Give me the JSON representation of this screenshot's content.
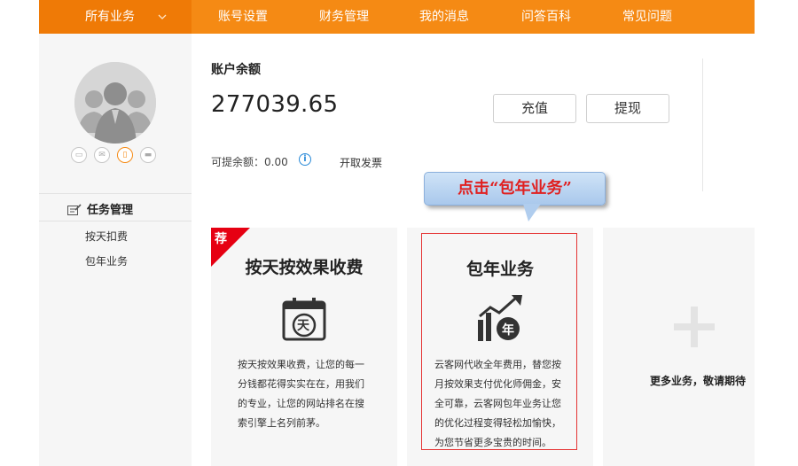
{
  "nav": {
    "all_services": "所有业务",
    "items": [
      "账号设置",
      "财务管理",
      "我的消息",
      "问答百科",
      "常见问题"
    ]
  },
  "sidebar": {
    "section_title": "任务管理",
    "links": [
      "按天扣费",
      "包年业务"
    ]
  },
  "balance": {
    "title": "账户余额",
    "amount": "277039.65",
    "recharge_label": "充值",
    "withdraw_label": "提现",
    "available_label": "可提余额：0.00",
    "invoice_label": "开取发票"
  },
  "callout": {
    "text": "点击“包年业务”"
  },
  "cards": [
    {
      "badge": "荐",
      "title": "按天按效果收费",
      "icon_char": "天",
      "desc": [
        "按天按效果收费，让您的每一",
        "分钱都花得实实在在，用我们",
        "的专业，让您的网站排名在搜",
        "索引擎上名列前茅。"
      ]
    },
    {
      "title": "包年业务",
      "icon_char": "年",
      "desc": [
        "云客网代收全年费用，替您按",
        "月按效果支付优化师佣金，安",
        "全可靠，云客网包年业务让您",
        "的优化过程变得轻松加愉快，",
        "为您节省更多宝贵的时间。"
      ]
    },
    {
      "more_text": "更多业务，敬请期待"
    }
  ],
  "colors": {
    "nav_bg": "#f58a14",
    "highlight": "#e53333",
    "badge": "#e60012"
  }
}
